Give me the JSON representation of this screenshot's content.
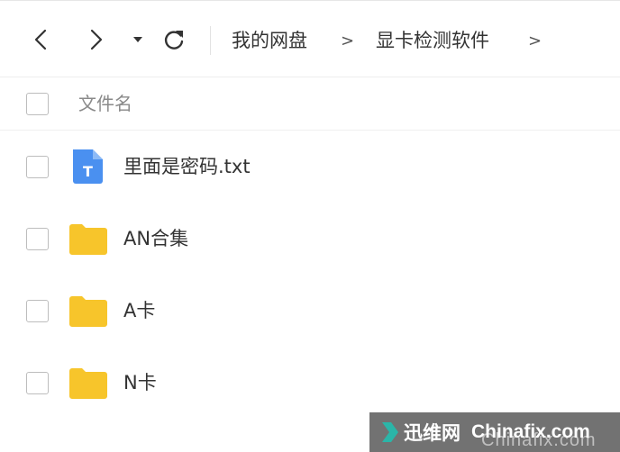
{
  "toolbar": {
    "back_icon": "chevron-left-icon",
    "forward_icon": "chevron-right-icon",
    "dropdown_icon": "caret-down-icon",
    "refresh_icon": "refresh-icon",
    "breadcrumb": [
      {
        "label": "我的网盘"
      },
      {
        "label": "显卡检测软件"
      }
    ],
    "separator": ">"
  },
  "list": {
    "header": {
      "name_column": "文件名"
    },
    "files": [
      {
        "name": "里面是密码.txt",
        "type": "txt",
        "icon": "txt-file-icon",
        "icon_color": "#4a90f0",
        "icon_glyph": "T"
      },
      {
        "name": "AN合集",
        "type": "folder",
        "icon": "folder-icon",
        "icon_color": "#f7c52b"
      },
      {
        "name": "A卡",
        "type": "folder",
        "icon": "folder-icon",
        "icon_color": "#f7c52b"
      },
      {
        "name": "N卡",
        "type": "folder",
        "icon": "folder-icon",
        "icon_color": "#f7c52b"
      }
    ]
  },
  "watermark": {
    "brand": "迅维网",
    "site": "Chinafix.com",
    "sub": "Chinafix.com"
  },
  "colors": {
    "folder": "#f7c52b",
    "txt_icon": "#4a90f0",
    "checkbox_border": "#bdbdbd",
    "header_text": "#8a8a8a"
  }
}
